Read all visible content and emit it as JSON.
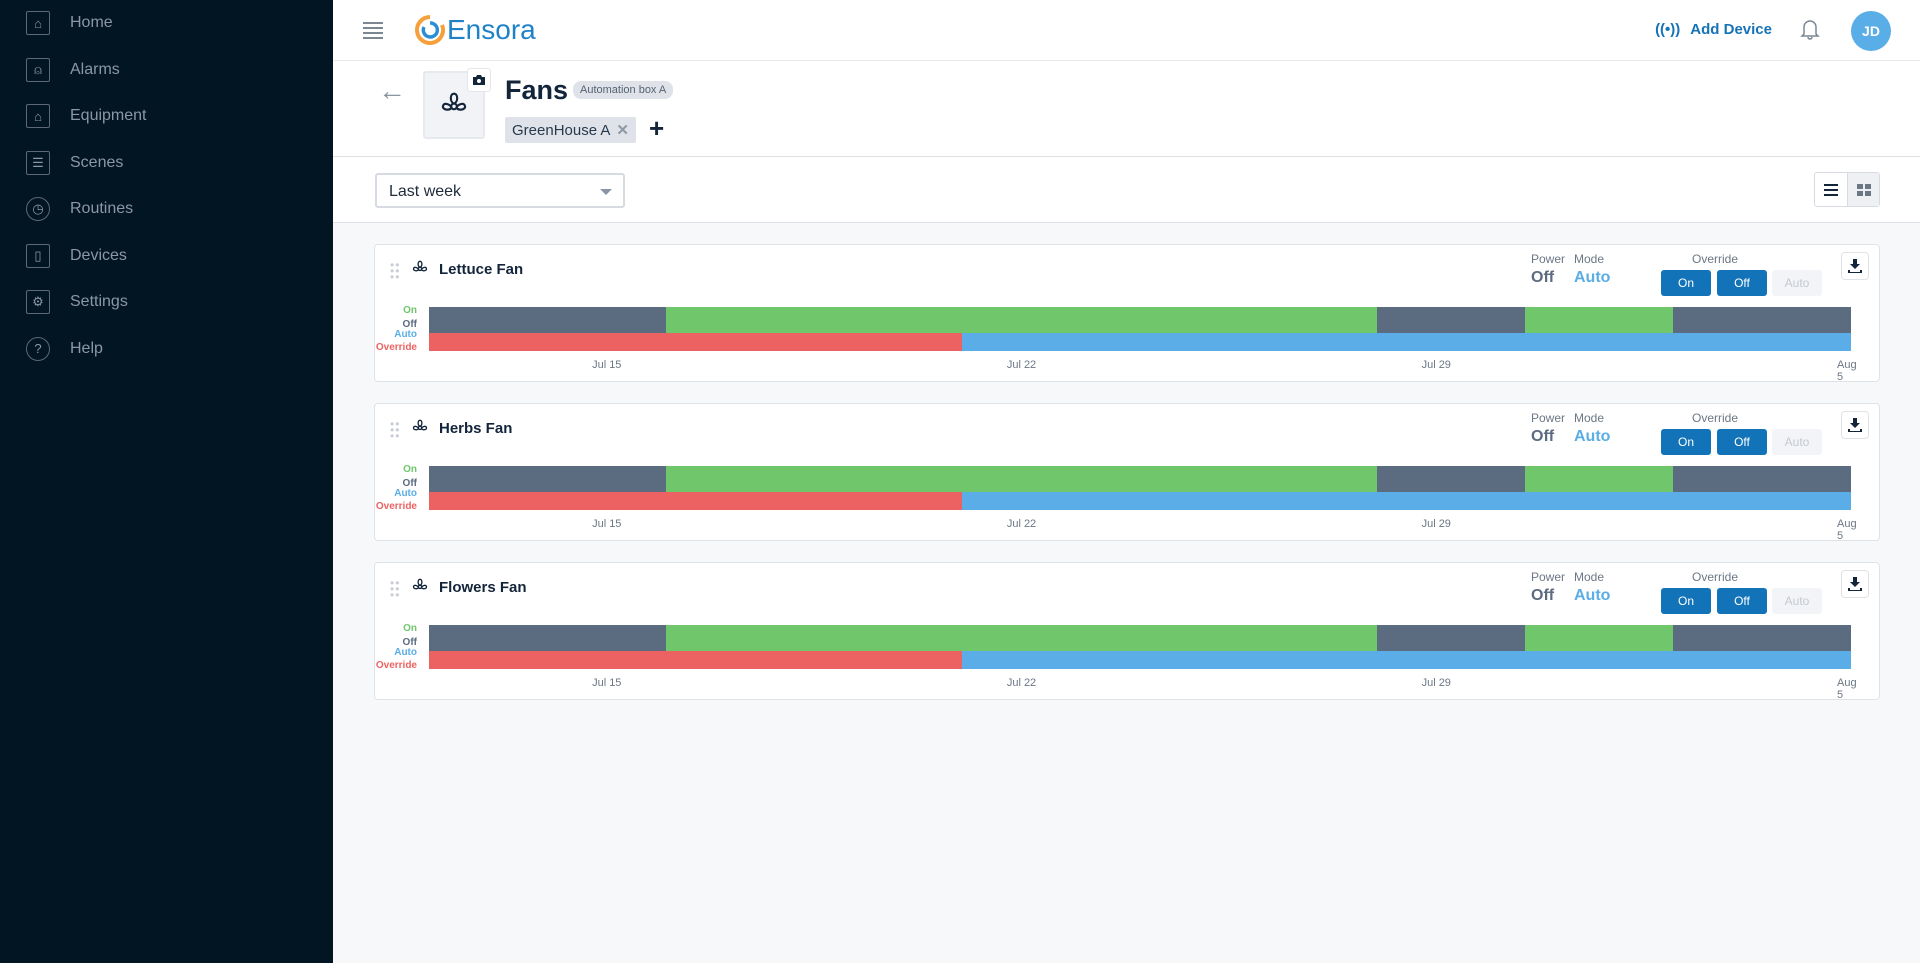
{
  "sidebar": {
    "items": [
      {
        "label": "Home",
        "icon": "greenhouse-icon"
      },
      {
        "label": "Alarms",
        "icon": "alarm-icon"
      },
      {
        "label": "Equipment",
        "icon": "equipment-icon"
      },
      {
        "label": "Scenes",
        "icon": "sliders-icon"
      },
      {
        "label": "Routines",
        "icon": "clock-icon"
      },
      {
        "label": "Devices",
        "icon": "device-icon"
      },
      {
        "label": "Settings",
        "icon": "gear-icon"
      },
      {
        "label": "Help",
        "icon": "help-icon"
      }
    ]
  },
  "header": {
    "brand": "Ensora",
    "add_device": "Add Device",
    "avatar": "JD"
  },
  "page": {
    "title": "Fans",
    "badge": "Automation box A",
    "tag": "GreenHouse A",
    "tag_remove": "✕",
    "add": "+"
  },
  "filter": {
    "range": "Last week"
  },
  "labels": {
    "power": "Power",
    "mode": "Mode",
    "override": "Override",
    "on": "On",
    "off": "Off",
    "auto": "Auto",
    "y_on": "On",
    "y_off": "Off",
    "y_auto": "Auto",
    "y_override": "Override"
  },
  "colors": {
    "on": "#70c66b",
    "off": "#5b6b80",
    "auto": "#5aade6",
    "override": "#ec6262"
  },
  "chart_data": {
    "type": "timeline",
    "x_domain_days": [
      0,
      24
    ],
    "x_origin": "Jul 12",
    "ticks": [
      {
        "day": 3,
        "label": "Jul 15"
      },
      {
        "day": 10,
        "label": "Jul 22"
      },
      {
        "day": 17,
        "label": "Jul 29"
      },
      {
        "day": 24,
        "label": "Aug 5"
      }
    ],
    "power_segments": [
      [
        0,
        4,
        "off"
      ],
      [
        4,
        16,
        "on"
      ],
      [
        16,
        18.5,
        "off"
      ],
      [
        18.5,
        21,
        "on"
      ],
      [
        21,
        24,
        "off"
      ]
    ],
    "mode_segments": [
      [
        0,
        9,
        "override"
      ],
      [
        9,
        24,
        "auto"
      ]
    ]
  },
  "devices": [
    {
      "name": "Lettuce Fan",
      "power": "Off",
      "mode": "Auto"
    },
    {
      "name": "Herbs Fan",
      "power": "Off",
      "mode": "Auto"
    },
    {
      "name": "Flowers Fan",
      "power": "Off",
      "mode": "Auto"
    }
  ]
}
